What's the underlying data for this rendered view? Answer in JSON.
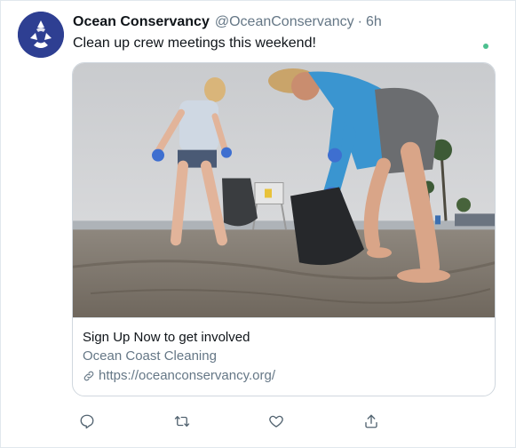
{
  "tweet": {
    "author_name": "Ocean Conservancy",
    "handle": "@OceanConservancy",
    "separator": "·",
    "time": "6h",
    "text": "Clean up crew meetings this weekend!"
  },
  "card": {
    "title": "Sign Up Now to get involved",
    "description": "Ocean Coast Cleaning",
    "url": "https://oceanconservancy.org/"
  },
  "actions": [
    "reply-icon",
    "retweet-icon",
    "like-icon",
    "share-icon"
  ],
  "colors": {
    "avatar_bg": "#2e3f92",
    "secondary_text": "#657786",
    "status_dot": "#4cc08f"
  }
}
